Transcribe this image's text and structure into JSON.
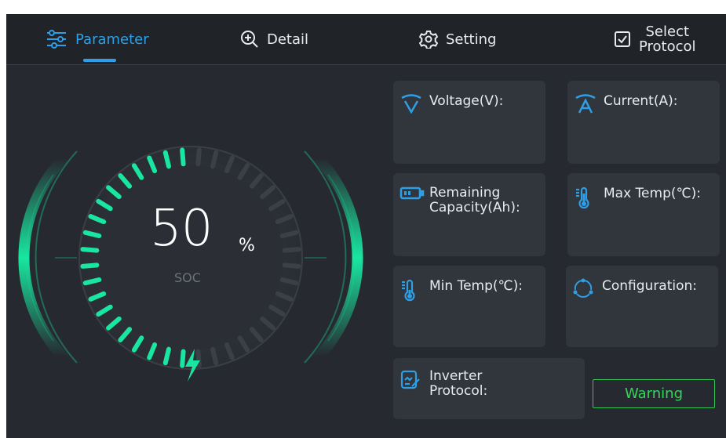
{
  "tabs": [
    {
      "label": "Parameter",
      "icon": "sliders-icon",
      "active": true
    },
    {
      "label": "Detail",
      "icon": "zoom-in-icon",
      "active": false
    },
    {
      "label": "Setting",
      "icon": "gear-icon",
      "active": false
    },
    {
      "label_line1": "Select",
      "label_line2": "Protocol",
      "icon": "checkbox-icon",
      "active": false
    }
  ],
  "gauge": {
    "soc_value": "50",
    "soc_unit": "%",
    "soc_label": "SOC",
    "soc_level": 0.5,
    "icon": "lightning-icon"
  },
  "cards": {
    "voltage": {
      "label": "Voltage(V):",
      "icon": "voltage-icon"
    },
    "current": {
      "label": "Current(A):",
      "icon": "current-icon"
    },
    "remaining": {
      "label_line1": "Remaining",
      "label_line2": "Capacity(Ah):",
      "icon": "battery-icon"
    },
    "max_temp": {
      "label": "Max Temp(℃):",
      "icon": "thermometer-icon"
    },
    "min_temp": {
      "label": "Min Temp(℃):",
      "icon": "thermometer-icon"
    },
    "configuration": {
      "label": "Configuration:",
      "icon": "config-icon"
    },
    "inverter": {
      "label_line1": "Inverter",
      "label_line2": "Protocol:",
      "icon": "document-edit-icon"
    }
  },
  "warning": {
    "label": "Warning"
  },
  "colors": {
    "accent_blue": "#2e9fe6",
    "gauge_green": "#19e6a0",
    "warning_green": "#34d65a",
    "background": "#262a30",
    "card": "#31353c"
  }
}
